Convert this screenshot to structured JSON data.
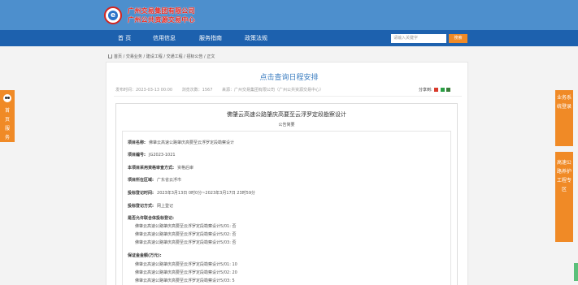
{
  "header": {
    "logo_letter": "e",
    "org_line1": "广州交易集团有限公司",
    "org_line2": "广州公共资源交易中心"
  },
  "nav": {
    "items": [
      "首 页",
      "信用信息",
      "服务指南",
      "政策法规"
    ],
    "search_placeholder": "请输入关键字",
    "search_button": "搜索"
  },
  "breadcrumb": "首页 / 交易业务 / 建设工程 / 交通工程 / 招标公告 / 正文",
  "schedule_link": "点击查询日程安排",
  "meta": {
    "publish_time": "发布时间：2023-03-13 00:00",
    "views": "浏览次数：1567",
    "source": "来源：广州交易集团有限公司（广州公共资源交易中心）"
  },
  "share_label": "分享到:",
  "doc": {
    "title": "佛肇云高速公路肇庆高要至云浮罗定段勘察设计",
    "subtitle": "公告简要",
    "project_name_label": "项目名称:",
    "project_name": "佛肇云高速公路肇庆高要至云浮罗定段勘察设计",
    "project_no_label": "项目编号:",
    "project_no": "JG2023-1021",
    "review_label": "本项目采用资格审查方式:",
    "review": "资格后审",
    "region_label": "项目所在区域:",
    "region": "广东省云浮市",
    "reg_time_label": "投标登记时间:",
    "reg_time": "2023年3月13日 0时0分~2023年3月17日 23时59分",
    "reg_method_label": "投标登记方式:",
    "reg_method": "网上登记",
    "joint_label": "是否允许联合体投标登记:",
    "joint_items": [
      "佛肇云高速公路肇庆高要至云浮罗定段勘察设计5/01: 否",
      "佛肇云高速公路肇庆高要至云浮罗定段勘察设计5/02: 否",
      "佛肇云高速公路肇庆高要至云浮罗定段勘察设计5/03: 否"
    ],
    "deposit_label": "保证金金额(万元):",
    "deposit_items": [
      "佛肇云高速公路肇庆高要至云浮罗定段勘察设计5/01: 10",
      "佛肇云高速公路肇庆高要至云浮罗定段勘察设计5/02: 20",
      "佛肇云高速公路肇庆高要至云浮罗定段勘察设计5/03: 5"
    ]
  },
  "left_float": "首页服务",
  "right_float_1": "业务系统登录",
  "right_float_2": "高速公路养护工程专区",
  "colors": {
    "header": "#4d8fcd",
    "nav": "#1d61ae",
    "accent_orange": "#f08a26",
    "title_blue": "#3a7cc0"
  }
}
